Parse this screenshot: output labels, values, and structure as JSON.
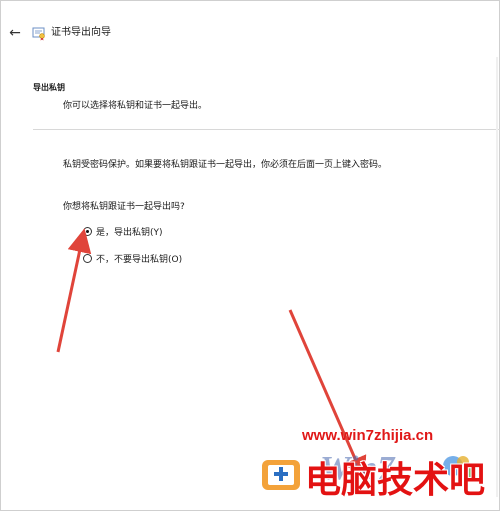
{
  "window": {
    "title": "证书导出向导",
    "back_icon": "back-arrow-icon",
    "cert_icon": "certificate-icon"
  },
  "header": {
    "title": "导出私钥",
    "subtitle": "你可以选择将私钥和证书一起导出。"
  },
  "body": {
    "description": "私钥受密码保护。如果要将私钥跟证书一起导出，你必须在后面一页上键入密码。",
    "question": "你想将私钥跟证书一起导出吗?",
    "options": [
      {
        "label": "是，导出私钥(Y)",
        "selected": true
      },
      {
        "label": "不，不要导出私钥(O)",
        "selected": false
      }
    ]
  },
  "watermark": {
    "url": "www.win7zhijia.cn",
    "brand": "电脑技术吧",
    "logo_text": "Win7"
  },
  "colors": {
    "accent_arrow": "#e0443a",
    "watermark_red": "#e31212",
    "text": "#1a1a1a",
    "divider": "#d8d8d8"
  }
}
